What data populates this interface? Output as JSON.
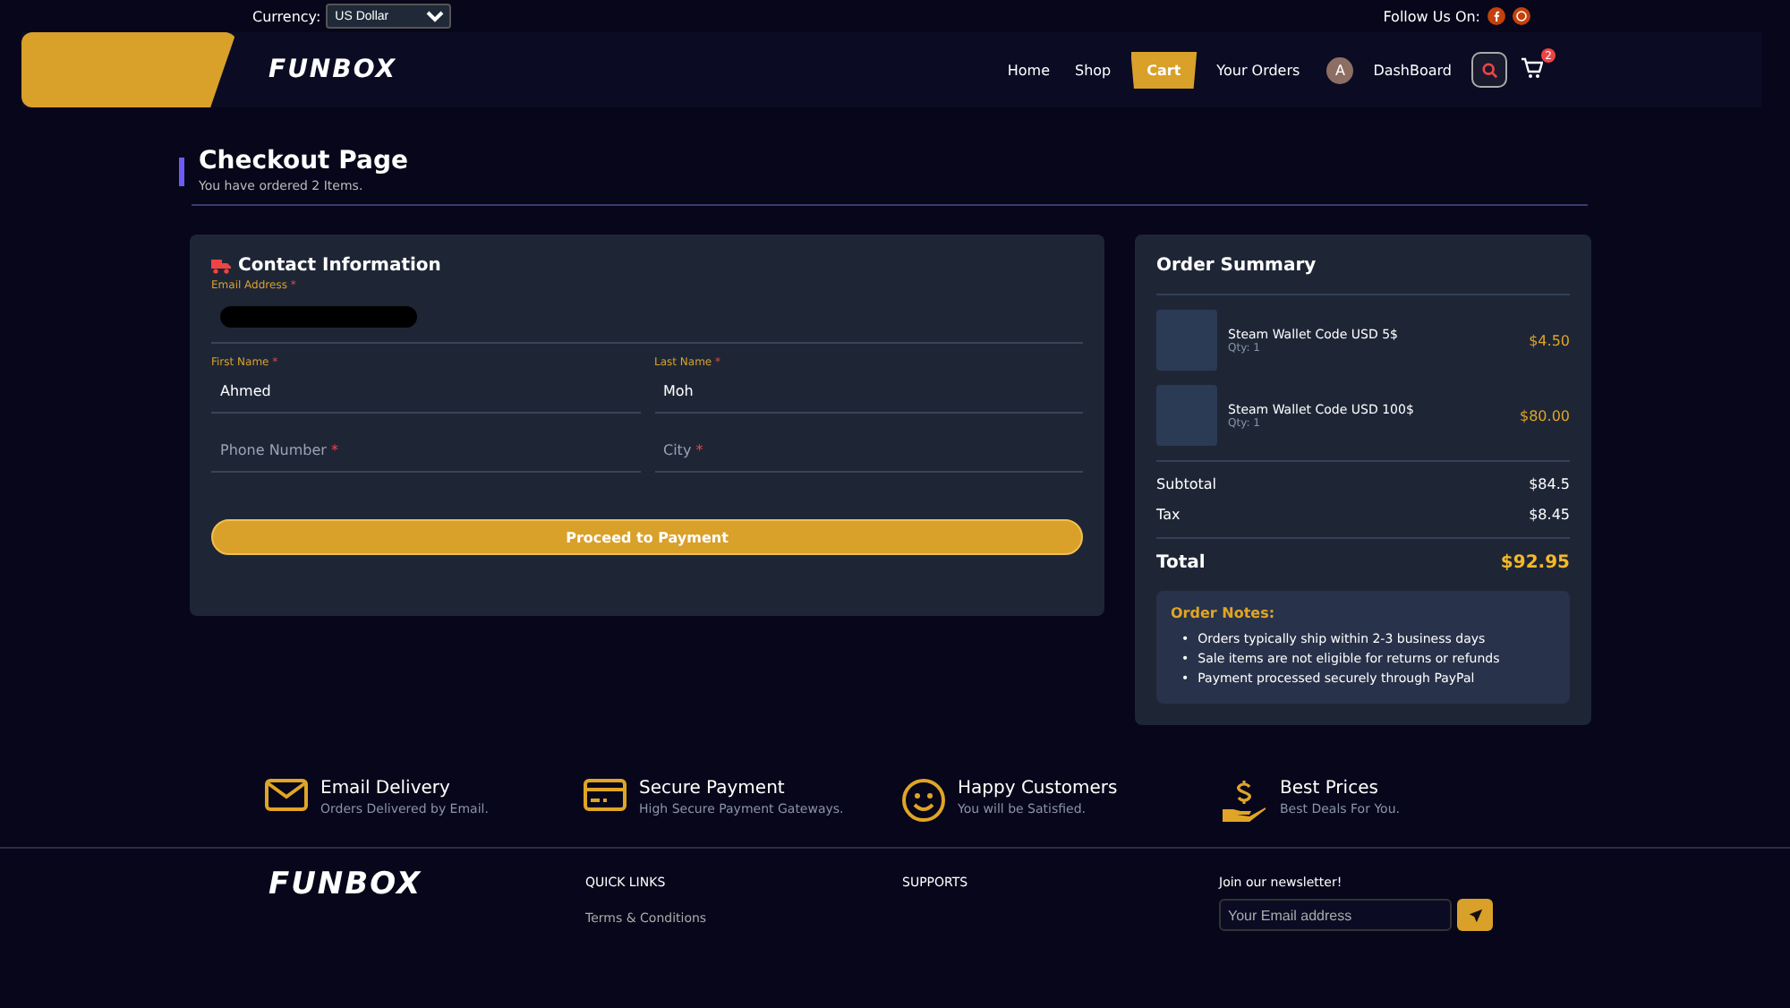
{
  "topbar": {
    "currency_label": "Currency:",
    "currency_value": "US Dollar",
    "follow_label": "Follow Us On:"
  },
  "nav": {
    "logo": "FUNBOX",
    "items": [
      {
        "label": "Home",
        "selected": false
      },
      {
        "label": "Shop",
        "selected": false
      },
      {
        "label": "Cart",
        "selected": true
      },
      {
        "label": "Your Orders",
        "selected": false
      }
    ],
    "avatar": "A",
    "dashboard": "DashBoard",
    "cart_count": "2"
  },
  "header": {
    "title": "Checkout Page",
    "subtitle": "You have ordered 2 Items."
  },
  "contact": {
    "title": "Contact Information",
    "email_label": "Email Address",
    "email_required": "*",
    "fields": [
      {
        "label": "First Name",
        "value": "Ahmed",
        "required": "*"
      },
      {
        "label": "Last Name",
        "value": "Moh",
        "required": "*"
      },
      {
        "placeholder": "Phone Number",
        "required": "*"
      },
      {
        "placeholder": "City",
        "required": "*"
      }
    ],
    "button": "Proceed to Payment"
  },
  "summary": {
    "title": "Order Summary",
    "items": [
      {
        "name": "Steam Wallet Code USD 5$",
        "qty": "Qty: 1",
        "price": "$4.50"
      },
      {
        "name": "Steam Wallet Code USD 100$",
        "qty": "Qty: 1",
        "price": "$80.00"
      }
    ],
    "subtotal_label": "Subtotal",
    "subtotal": "$84.5",
    "tax_label": "Tax",
    "tax": "$8.45",
    "total_label": "Total",
    "total": "$92.95",
    "notes_title": "Order Notes:",
    "notes": [
      {
        "bullet": "•",
        "text": "Orders typically ship within 2-3 business days"
      },
      {
        "bullet": "•",
        "text": "Sale items are not eligible for returns or refunds"
      },
      {
        "bullet": "•",
        "text": "Payment processed securely through PayPal"
      }
    ]
  },
  "features": [
    {
      "kind": "mail",
      "title": "Email Delivery",
      "text": "Orders Delivered by Email."
    },
    {
      "kind": "card",
      "title": "Secure Payment",
      "text": "High Secure Payment Gateways."
    },
    {
      "kind": "smile",
      "title": "Happy Customers",
      "text": "You will be Satisfied."
    },
    {
      "kind": "price",
      "title": "Best Prices",
      "text": "Best Deals For You."
    }
  ],
  "footer": {
    "logo": "FUNBOX",
    "quick_links_title": "QUICK LINKS",
    "quick_links": [
      "Terms & Conditions"
    ],
    "supports_title": "SUPPORTS",
    "newsletter_title": "Join our newsletter!",
    "newsletter_placeholder": "Your Email address"
  }
}
